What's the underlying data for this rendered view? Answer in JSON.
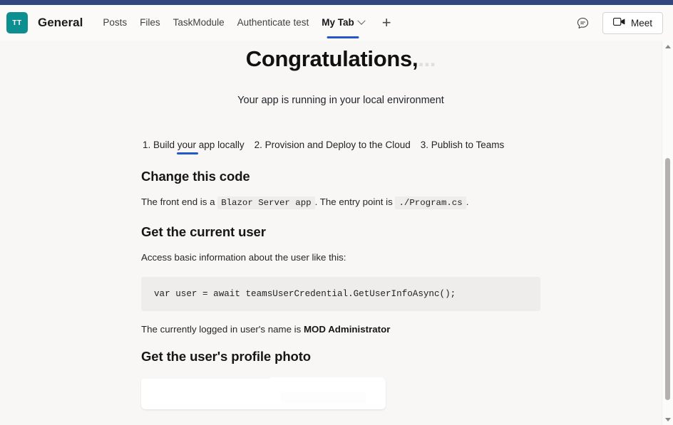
{
  "window": {
    "accent_color": "#2e4a85"
  },
  "header": {
    "team_avatar_initials": "TT",
    "channel_title": "General",
    "tabs": [
      {
        "label": "Posts",
        "active": false
      },
      {
        "label": "Files",
        "active": false
      },
      {
        "label": "TaskModule",
        "active": false
      },
      {
        "label": "Authenticate test",
        "active": false
      },
      {
        "label": "My Tab",
        "active": true
      }
    ],
    "add_tab_label": "+",
    "feedback_icon": "chat-feedback-icon",
    "meet_button": {
      "label": "Meet",
      "icon": "video-camera-icon"
    },
    "active_tab_accent": "#2358c8"
  },
  "main": {
    "hero": {
      "title": "Congratulations,",
      "title_ghost": "...",
      "subtitle": "Your app is running in your local environment"
    },
    "steps": [
      {
        "label": "1. Build your app locally",
        "active": true
      },
      {
        "label": "2. Provision and Deploy to the Cloud",
        "active": false
      },
      {
        "label": "3. Publish to Teams",
        "active": false
      }
    ],
    "sections": {
      "change_code": {
        "heading": "Change this code",
        "text_before": "The front end is a",
        "code_1": "Blazor Server app",
        "text_middle": ". The entry point is",
        "code_2": "./Program.cs",
        "text_after": "."
      },
      "current_user": {
        "heading": "Get the current user",
        "intro": "Access basic information about the user like this:",
        "code_block": "var user = await teamsUserCredential.GetUserInfoAsync();",
        "logged_in_prefix": "The currently logged in user's name is",
        "logged_in_name": "MOD Administrator"
      },
      "profile_photo": {
        "heading": "Get the user's profile photo"
      }
    }
  },
  "scrollbar": {
    "up_arrow": "scroll-up-arrow",
    "down_arrow": "scroll-down-arrow"
  }
}
